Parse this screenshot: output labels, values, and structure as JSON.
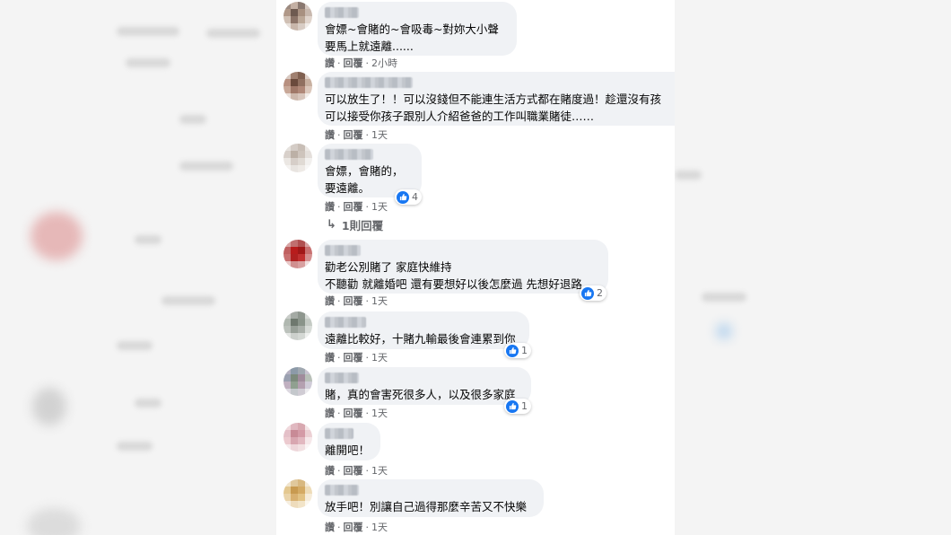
{
  "comments": [
    {
      "text": "會嫖~會賭的~會吸毒~對妳大小聲\n要馬上就遠離......",
      "like_label": "讚",
      "reply_label": "回覆",
      "time": "2小時",
      "reaction_count": ""
    },
    {
      "text": "可以放生了！！可以沒錢但不能連生活方式都在賭度過！趁還沒有孩\n可以接受你孩子跟別人介紹爸爸的工作叫職業賭徒……",
      "like_label": "讚",
      "reply_label": "回覆",
      "time": "1天",
      "reaction_count": ""
    },
    {
      "text": "會嫖，會賭的，\n要遠離。",
      "like_label": "讚",
      "reply_label": "回覆",
      "time": "1天",
      "reaction_count": "4"
    },
    {
      "text": "勸老公別賭了 家庭快維持\n不聽勸 就離婚吧 還有要想好以後怎麼過 先想好退路",
      "like_label": "讚",
      "reply_label": "回覆",
      "time": "1天",
      "reaction_count": "2"
    },
    {
      "text": "遠離比較好，十賭九輸最後會連累到你",
      "like_label": "讚",
      "reply_label": "回覆",
      "time": "1天",
      "reaction_count": "1"
    },
    {
      "text": "賭，真的會害死很多人，以及很多家庭",
      "like_label": "讚",
      "reply_label": "回覆",
      "time": "1天",
      "reaction_count": "1"
    },
    {
      "text": "離開吧！",
      "like_label": "讚",
      "reply_label": "回覆",
      "time": "1天",
      "reaction_count": ""
    },
    {
      "text": "放手吧！別讓自己過得那麼辛苦又不快樂",
      "like_label": "讚",
      "reply_label": "回覆",
      "time": "1天",
      "reaction_count": ""
    }
  ],
  "replies_link": "1則回覆",
  "colors": {
    "bubble": "#f0f2f5",
    "like_blue": "#1877f2",
    "meta_text": "#65676b"
  }
}
